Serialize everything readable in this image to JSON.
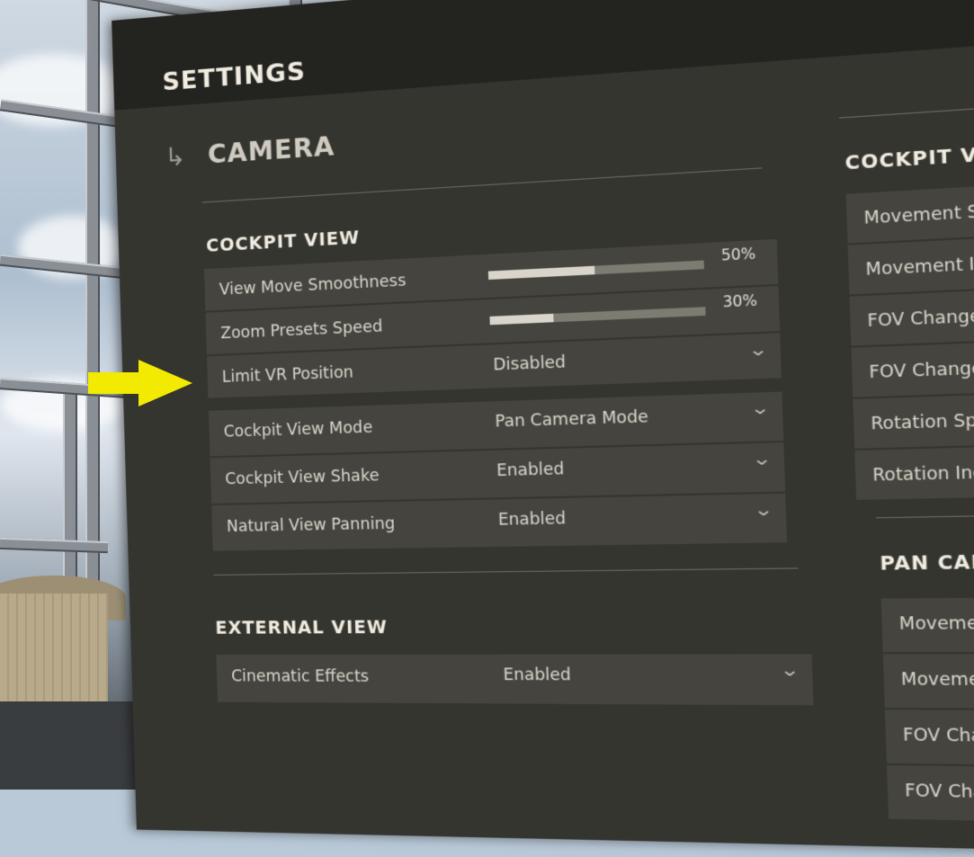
{
  "settings_title": "SETTINGS",
  "section": {
    "icon": "return-arrow-icon",
    "title": "CAMERA"
  },
  "cockpit_view": {
    "title": "COCKPIT VIEW",
    "sliders": [
      {
        "label": "View Move Smoothness",
        "percent": 50,
        "value_text": "50%"
      },
      {
        "label": "Zoom Presets Speed",
        "percent": 30,
        "value_text": "30%"
      }
    ],
    "limit_vr": {
      "label": "Limit VR Position",
      "value": "Disabled"
    },
    "dropdowns": [
      {
        "label": "Cockpit View Mode",
        "value": "Pan Camera Mode"
      },
      {
        "label": "Cockpit View Shake",
        "value": "Enabled"
      },
      {
        "label": "Natural View Panning",
        "value": "Enabled"
      }
    ]
  },
  "external_view": {
    "title": "EXTERNAL VIEW",
    "dropdowns": [
      {
        "label": "Cinematic Effects",
        "value": "Enabled"
      }
    ]
  },
  "cockpit_view_mode": {
    "title": "COCKPIT VIEW M",
    "rows": [
      "Movement Speed",
      "Movement Inertia",
      "FOV Change Speed",
      "FOV Change Inerti",
      "Rotation Speed",
      "Rotation Inertia"
    ]
  },
  "pan_camera": {
    "title": "PAN CAMERA",
    "rows": [
      "Movement Spee",
      "Movement Inert",
      "FOV Change Sp",
      "FOV Change In"
    ]
  },
  "annotation_arrow": {
    "color": "#f2ea00",
    "icon": "yellow-arrow-icon"
  },
  "colors": {
    "panel": "#353530",
    "header": "#232320",
    "row": "#45443e"
  }
}
